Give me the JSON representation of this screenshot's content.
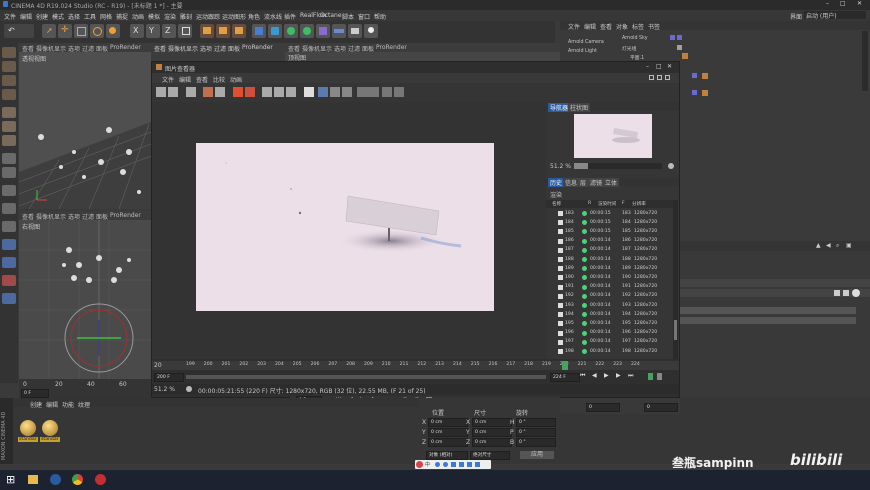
{
  "window": {
    "title": "CINEMA 4D R19.024 Studio (RC - R19) - [未标题 1 *] - 主要",
    "layout_label": "界面",
    "layout_value": "启动 (用户)"
  },
  "menu": [
    "文件",
    "编辑",
    "创建",
    "模式",
    "选择",
    "工具",
    "网格",
    "捕捉",
    "动画",
    "模拟",
    "渲染",
    "雕刻",
    "运动跟踪",
    "运动图形",
    "角色",
    "流水线",
    "插件",
    "RealFlow",
    "Octane",
    "脚本",
    "窗口",
    "帮助"
  ],
  "viewport_top": {
    "menu": [
      "查看",
      "摄像机",
      "显示",
      "选项",
      "过滤",
      "面板",
      "ProRender"
    ],
    "label": "透视视图"
  },
  "viewport_bottom": {
    "menu": [
      "查看",
      "摄像机",
      "显示",
      "选项",
      "过滤",
      "面板",
      "ProRender"
    ],
    "label": "右视图"
  },
  "viewport_right": {
    "menu": [
      "查看",
      "摄像机",
      "显示",
      "选项",
      "过滤",
      "面板",
      "ProRender"
    ],
    "label": "顶视图"
  },
  "picture_viewer": {
    "title": "图片查看器",
    "menu": [
      "文件",
      "编辑",
      "查看",
      "比较",
      "动画"
    ],
    "tabs": [
      "导航器",
      "柱状图"
    ],
    "zoom": "51.2 %",
    "history_tabs": [
      "历史",
      "信息",
      "层",
      "滤镜",
      "立体"
    ],
    "section": "渲染",
    "columns": [
      "名称",
      "R",
      "渲染时间",
      "F",
      "分辨率"
    ],
    "rows": [
      {
        "name": "183",
        "time": "00:00:15",
        "frame": "183",
        "res": "1280x720"
      },
      {
        "name": "184",
        "time": "00:00:15",
        "frame": "184",
        "res": "1280x720"
      },
      {
        "name": "185",
        "time": "00:00:15",
        "frame": "185",
        "res": "1280x720"
      },
      {
        "name": "186",
        "time": "00:00:14",
        "frame": "186",
        "res": "1280x720"
      },
      {
        "name": "187",
        "time": "00:00:14",
        "frame": "187",
        "res": "1280x720"
      },
      {
        "name": "188",
        "time": "00:00:14",
        "frame": "188",
        "res": "1280x720"
      },
      {
        "name": "189",
        "time": "00:00:14",
        "frame": "189",
        "res": "1280x720"
      },
      {
        "name": "190",
        "time": "00:00:14",
        "frame": "190",
        "res": "1280x720"
      },
      {
        "name": "191",
        "time": "00:00:14",
        "frame": "191",
        "res": "1280x720"
      },
      {
        "name": "192",
        "time": "00:00:14",
        "frame": "192",
        "res": "1280x720"
      },
      {
        "name": "193",
        "time": "00:00:14",
        "frame": "193",
        "res": "1280x720"
      },
      {
        "name": "194",
        "time": "00:00:14",
        "frame": "194",
        "res": "1280x720"
      },
      {
        "name": "195",
        "time": "00:00:14",
        "frame": "195",
        "res": "1280x720"
      },
      {
        "name": "196",
        "time": "00:00:14",
        "frame": "196",
        "res": "1280x720"
      },
      {
        "name": "197",
        "time": "00:00:14",
        "frame": "197",
        "res": "1280x720"
      },
      {
        "name": "198",
        "time": "00:00:14",
        "frame": "198",
        "res": "1280x720"
      }
    ],
    "timeline_ticks": [
      "199",
      "200",
      "201",
      "202",
      "203",
      "204",
      "205",
      "206",
      "207",
      "208",
      "209",
      "210",
      "211",
      "212",
      "213",
      "214",
      "215",
      "216",
      "217",
      "218",
      "219",
      "220",
      "221",
      "222",
      "223",
      "224"
    ],
    "frame_start": "20",
    "frame_field": "200 F",
    "frame_end_field": "224 F",
    "status_zoom": "51.2 %",
    "status_info": "00:00:05:21:55 (220 F)    尺寸: 1280x720, RGB (32 位), 22.55 MB,  (F 21 of 25)"
  },
  "objects": {
    "menu": [
      "文件",
      "编辑",
      "查看",
      "对象",
      "标签",
      "书签"
    ],
    "items": [
      "Arnold Sky",
      "灯光组",
      "Arnold Camera",
      "Arnold Light",
      "平面.1",
      "立方体"
    ]
  },
  "coords": {
    "headers": [
      "位置",
      "尺寸",
      "旋转"
    ],
    "rows": [
      {
        "axis": "X",
        "pos": "0 cm",
        "size": "0 cm",
        "rot": "H",
        "rotv": "0 °"
      },
      {
        "axis": "Y",
        "pos": "0 cm",
        "size": "0 cm",
        "rot": "P",
        "rotv": "0 °"
      },
      {
        "axis": "Z",
        "pos": "0 cm",
        "size": "0 cm",
        "rot": "B",
        "rotv": "0 °"
      }
    ],
    "mode_select": "对象 (相对)",
    "size_select": "绝对尺寸",
    "apply": "应用"
  },
  "materials": {
    "menu": [
      "创建",
      "编辑",
      "功能",
      "纹理"
    ],
    "items": [
      "standar",
      "standar"
    ]
  },
  "timeline_main": {
    "ticks": [
      "0",
      "20",
      "40",
      "60"
    ],
    "frame": "0 F",
    "frame2": "0 F"
  },
  "watermark": {
    "author": "叁瓶sampinn",
    "brand": "bilibili"
  },
  "brand_vertical": "MAXON CINEMA 4D"
}
